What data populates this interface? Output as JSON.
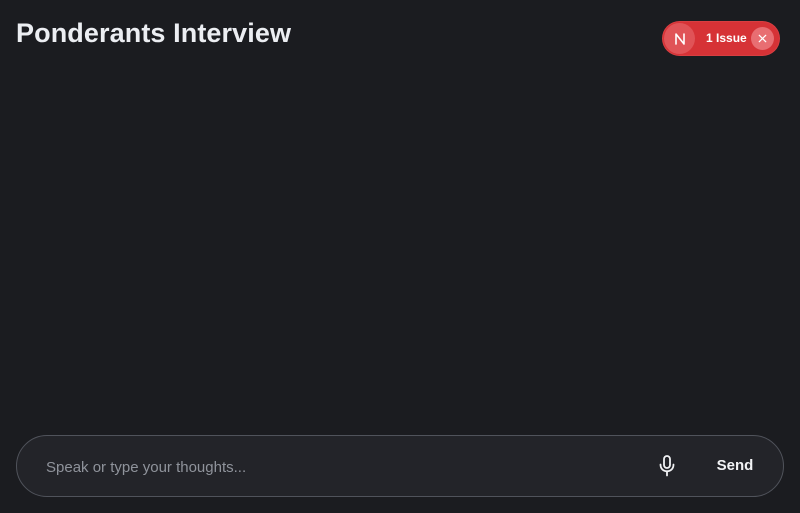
{
  "header": {
    "title": "Ponderants Interview"
  },
  "issue_badge": {
    "logo_icon": "nextjs-n-icon",
    "label": "1 Issue",
    "close_icon": "close-icon",
    "color": "#d63236"
  },
  "composer": {
    "input_value": "",
    "placeholder": "Speak or type your thoughts...",
    "mic_icon": "microphone-icon",
    "send_label": "Send"
  },
  "theme": {
    "background": "#1b1c20",
    "composer_border": "#50535b"
  }
}
